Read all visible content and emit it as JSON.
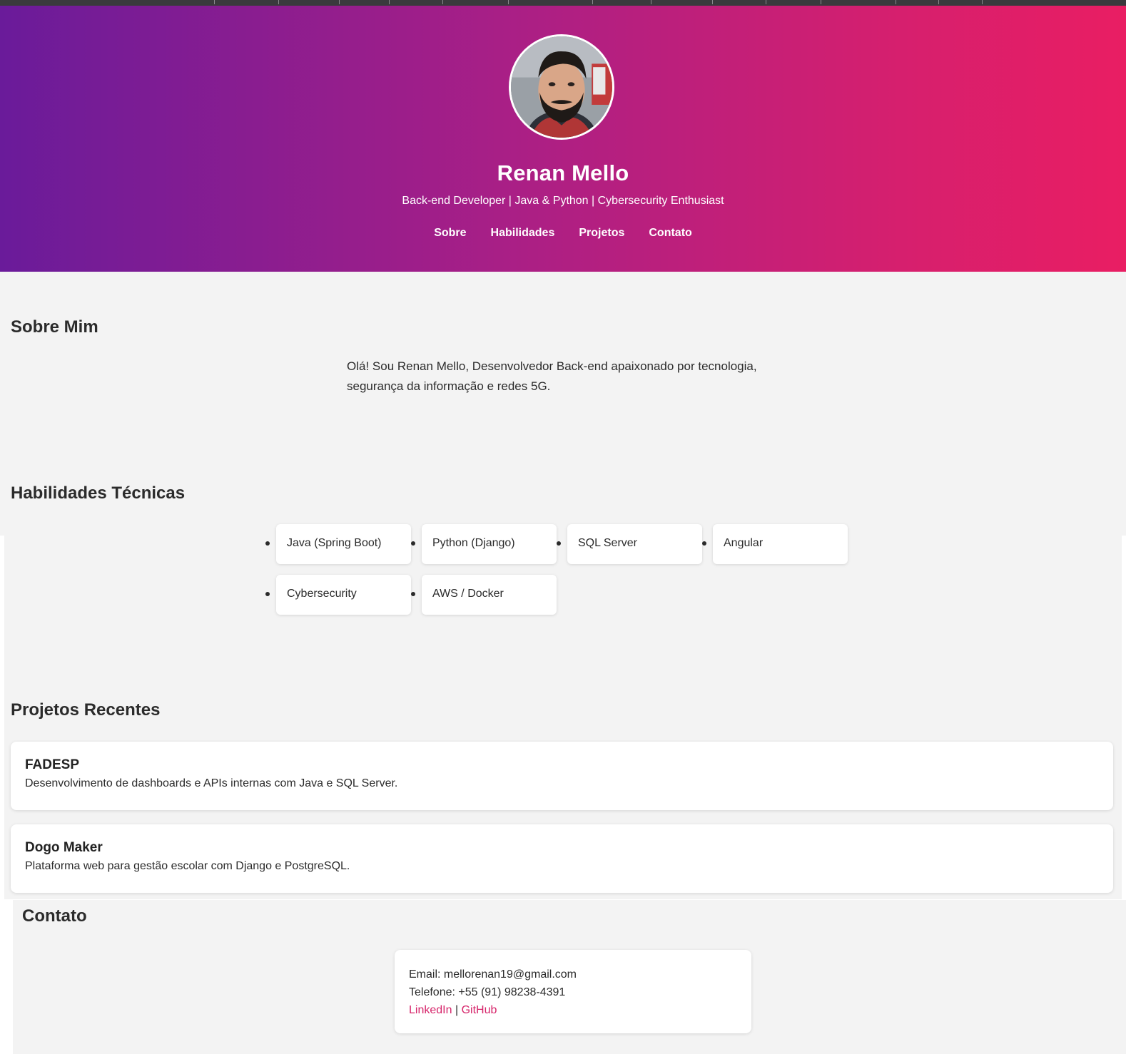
{
  "header": {
    "name": "Renan Mello",
    "subtitle": "Back-end Developer | Java & Python | Cybersecurity Enthusiast",
    "nav": [
      "Sobre",
      "Habilidades",
      "Projetos",
      "Contato"
    ],
    "gradient_start": "#6a1b9a",
    "gradient_end": "#e91e63"
  },
  "about": {
    "title": "Sobre Mim",
    "line1": "Olá! Sou Renan Mello, Desenvolvedor Back-end apaixonado por tecnologia,",
    "line2": "segurança da informação e redes 5G."
  },
  "skills": {
    "title": "Habilidades Técnicas",
    "items": [
      "Java (Spring Boot)",
      "Python (Django)",
      "SQL Server",
      "Angular",
      "Cybersecurity",
      "AWS / Docker"
    ]
  },
  "projects": {
    "title": "Projetos Recentes",
    "items": [
      {
        "name": "FADESP",
        "description": "Desenvolvimento de dashboards e APIs internas com Java e SQL Server."
      },
      {
        "name": "Dogo Maker",
        "description": "Plataforma web para gestão escolar com Django e PostgreSQL."
      }
    ]
  },
  "contact": {
    "title": "Contato",
    "email": "Email: mellorenan19@gmail.com",
    "phone": "Telefone: +55 (91) 98238-4391",
    "linkedin": "LinkedIn",
    "separator": "|",
    "github": "GitHub",
    "link_color": "#d6246a"
  }
}
